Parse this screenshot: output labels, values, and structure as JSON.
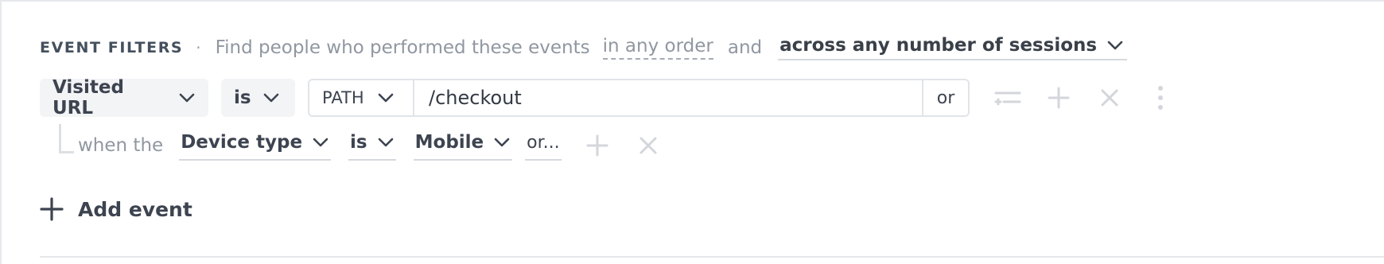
{
  "header": {
    "title": "EVENT FILTERS",
    "separator": "·",
    "description": "Find people who performed these events",
    "order_select": "in any order",
    "conjunction": "and",
    "sessions_select": "across any number of sessions"
  },
  "filter": {
    "event_select": "Visited URL",
    "operator_select": "is",
    "url_part_select": "PATH",
    "value": "/checkout",
    "or_button": "or"
  },
  "condition": {
    "prefix": "when the",
    "property_select": "Device type",
    "operator_select": "is",
    "value_select": "Mobile",
    "or_button": "or..."
  },
  "add_event": {
    "label": "Add event"
  },
  "icons": {
    "row_actions": [
      "add-condition-icon",
      "plus-icon",
      "close-icon",
      "more-vertical-icon"
    ],
    "condition_actions": [
      "plus-icon",
      "close-icon"
    ]
  },
  "colors": {
    "text": "#3d4450",
    "muted": "#9097a1",
    "pill_bg": "#f3f4f6",
    "border": "#e1e4e8",
    "icon_disabled": "#cfd3d8"
  }
}
